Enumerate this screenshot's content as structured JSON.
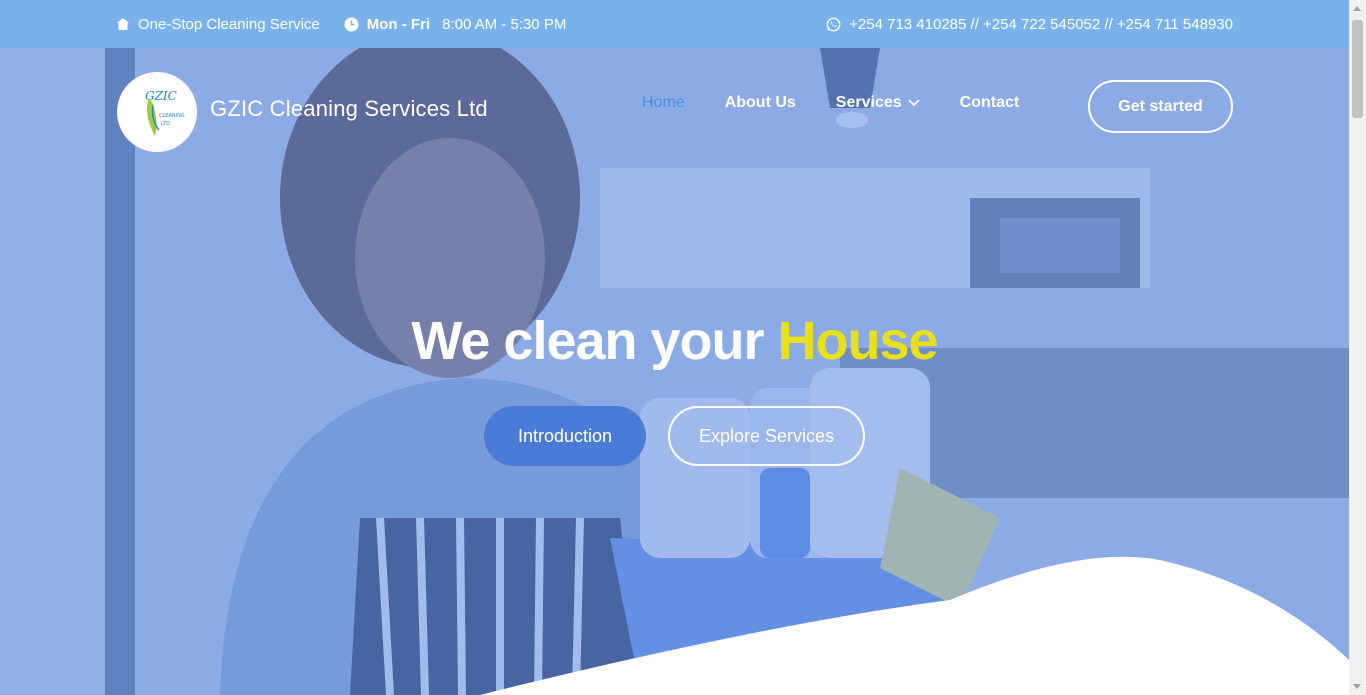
{
  "topbar": {
    "tagline": "One-Stop Cleaning Service",
    "hours_days": "Mon - Fri",
    "hours_time": "8:00 AM - 5:30 PM",
    "phones": "+254 713 410285 // +254 722 545052 // +254 711 548930",
    "icons": [
      "home-icon",
      "clock-icon",
      "whatsapp-icon"
    ]
  },
  "brand": {
    "name": "GZIC Cleaning Services Ltd",
    "logo_icon": "gzic-logo"
  },
  "nav": {
    "items": [
      {
        "label": "Home",
        "active": true
      },
      {
        "label": "About Us"
      },
      {
        "label": "Services",
        "has_dropdown": true
      },
      {
        "label": "Contact"
      }
    ],
    "cta": "Get started"
  },
  "hero": {
    "headline_prefix": "We clean your",
    "headline_highlight": "House",
    "primary_button": "Introduction",
    "secondary_button": "Explore Services"
  },
  "colors": {
    "topbar_bg": "#79b2ea",
    "accent_blue": "#4a90e2",
    "highlight_yellow": "#e8e01a",
    "button_blue": "#4a7bd6"
  }
}
